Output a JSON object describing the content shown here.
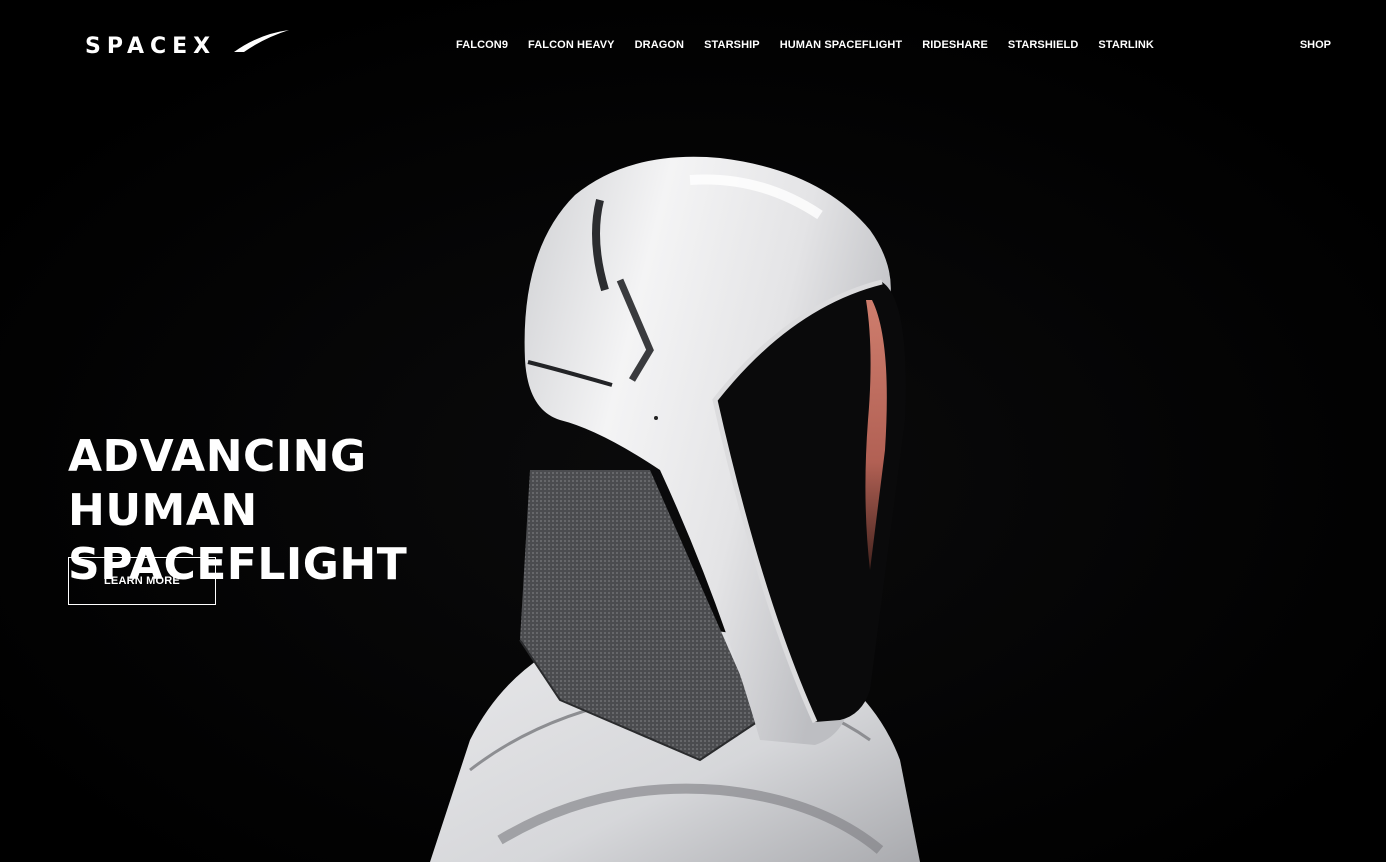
{
  "brand": {
    "logo_text": "SPACEX"
  },
  "nav": {
    "items": [
      {
        "label": "FALCON9"
      },
      {
        "label": "FALCON HEAVY"
      },
      {
        "label": "DRAGON"
      },
      {
        "label": "STARSHIP"
      },
      {
        "label": "HUMAN SPACEFLIGHT"
      },
      {
        "label": "RIDESHARE"
      },
      {
        "label": "STARSHIELD"
      },
      {
        "label": "STARLINK"
      }
    ],
    "shop_label": "SHOP"
  },
  "hero": {
    "title_line1": "ADVANCING HUMAN",
    "title_line2": "SPACEFLIGHT",
    "cta_label": "LEARN MORE",
    "image_subject": "astronaut-helmet-profile"
  },
  "colors": {
    "background": "#000000",
    "text": "#ffffff",
    "suit": "#e6e6e8",
    "visor_glow": "#d9786a"
  }
}
